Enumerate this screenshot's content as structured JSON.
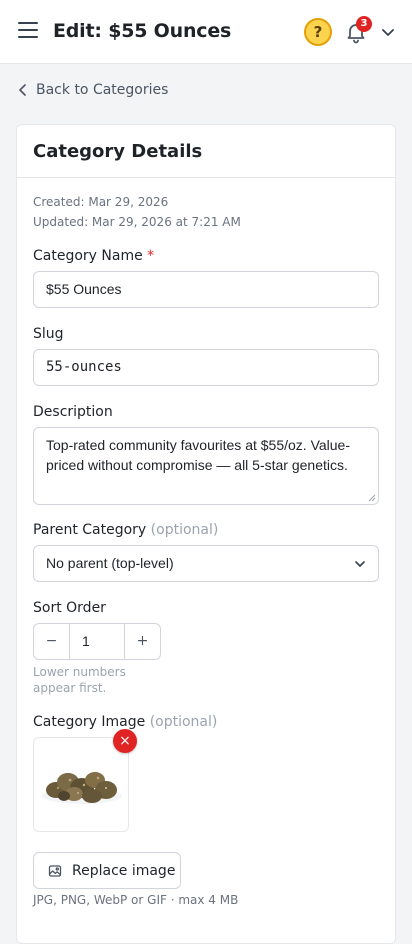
{
  "header": {
    "title": "Edit: $55 Ounces",
    "help_label": "?",
    "notification_count": "3",
    "icons": [
      "menu-icon",
      "help-icon",
      "bell-icon",
      "chevron-down-icon"
    ],
    "help_color": "#fcd34d",
    "badge_color": "#e02424"
  },
  "nav": {
    "back_label": "Back to Categories"
  },
  "card": {
    "title": "Category Details",
    "created": "Created: Mar 29, 2026",
    "updated": "Updated: Mar 29, 2026 at 7:21 AM"
  },
  "fields": {
    "name": {
      "label": "Category Name",
      "required_mark": "*",
      "value": "$55 Ounces"
    },
    "slug": {
      "label": "Slug",
      "value": "55-ounces"
    },
    "description": {
      "label": "Description",
      "value": "Top-rated community favourites at $55/oz. Value-priced without compromise — all 5-star genetics."
    },
    "parent": {
      "label": "Parent Category",
      "optional": "(optional)",
      "selected": "No parent (top-level)"
    },
    "sort_order": {
      "label": "Sort Order",
      "value": "1",
      "minus": "−",
      "plus": "+",
      "hint": "Lower numbers appear first."
    },
    "image": {
      "label": "Category Image",
      "optional": "(optional)",
      "remove": "×",
      "replace_label": "Replace image",
      "hint": "JPG, PNG, WebP or GIF · max 4 MB"
    }
  }
}
